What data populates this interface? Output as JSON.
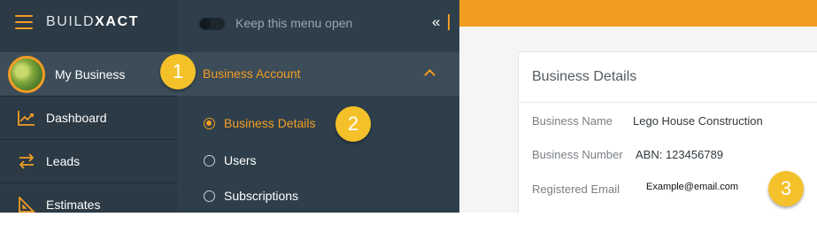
{
  "brand": {
    "logo_light": "BUILD",
    "logo_bold": "XACT"
  },
  "sidebar": {
    "items": [
      {
        "label": "My Business",
        "icon": "avatar"
      },
      {
        "label": "Dashboard",
        "icon": "chart-icon"
      },
      {
        "label": "Leads",
        "icon": "arrows-icon"
      },
      {
        "label": "Estimates",
        "icon": "ruler-triangle-icon"
      }
    ]
  },
  "submenu": {
    "keep_open_label": "Keep this menu open",
    "collapse_glyph": "«",
    "section_title": "Business Account",
    "options": [
      {
        "label": "Business Details",
        "selected": true
      },
      {
        "label": "Users",
        "selected": false
      },
      {
        "label": "Subscriptions",
        "selected": false
      }
    ]
  },
  "main": {
    "card_title": "Business Details",
    "fields": [
      {
        "label": "Business Name",
        "value": "Lego House Construction"
      },
      {
        "label": "Business Number",
        "value": "ABN: 123456789"
      },
      {
        "label": "Registered Email",
        "value": "Example@email.com"
      }
    ]
  },
  "callouts": [
    "1",
    "2",
    "3"
  ],
  "colors": {
    "accent": "#f39c22",
    "sidebar": "#2b3a45",
    "callout": "#f5c12a"
  }
}
